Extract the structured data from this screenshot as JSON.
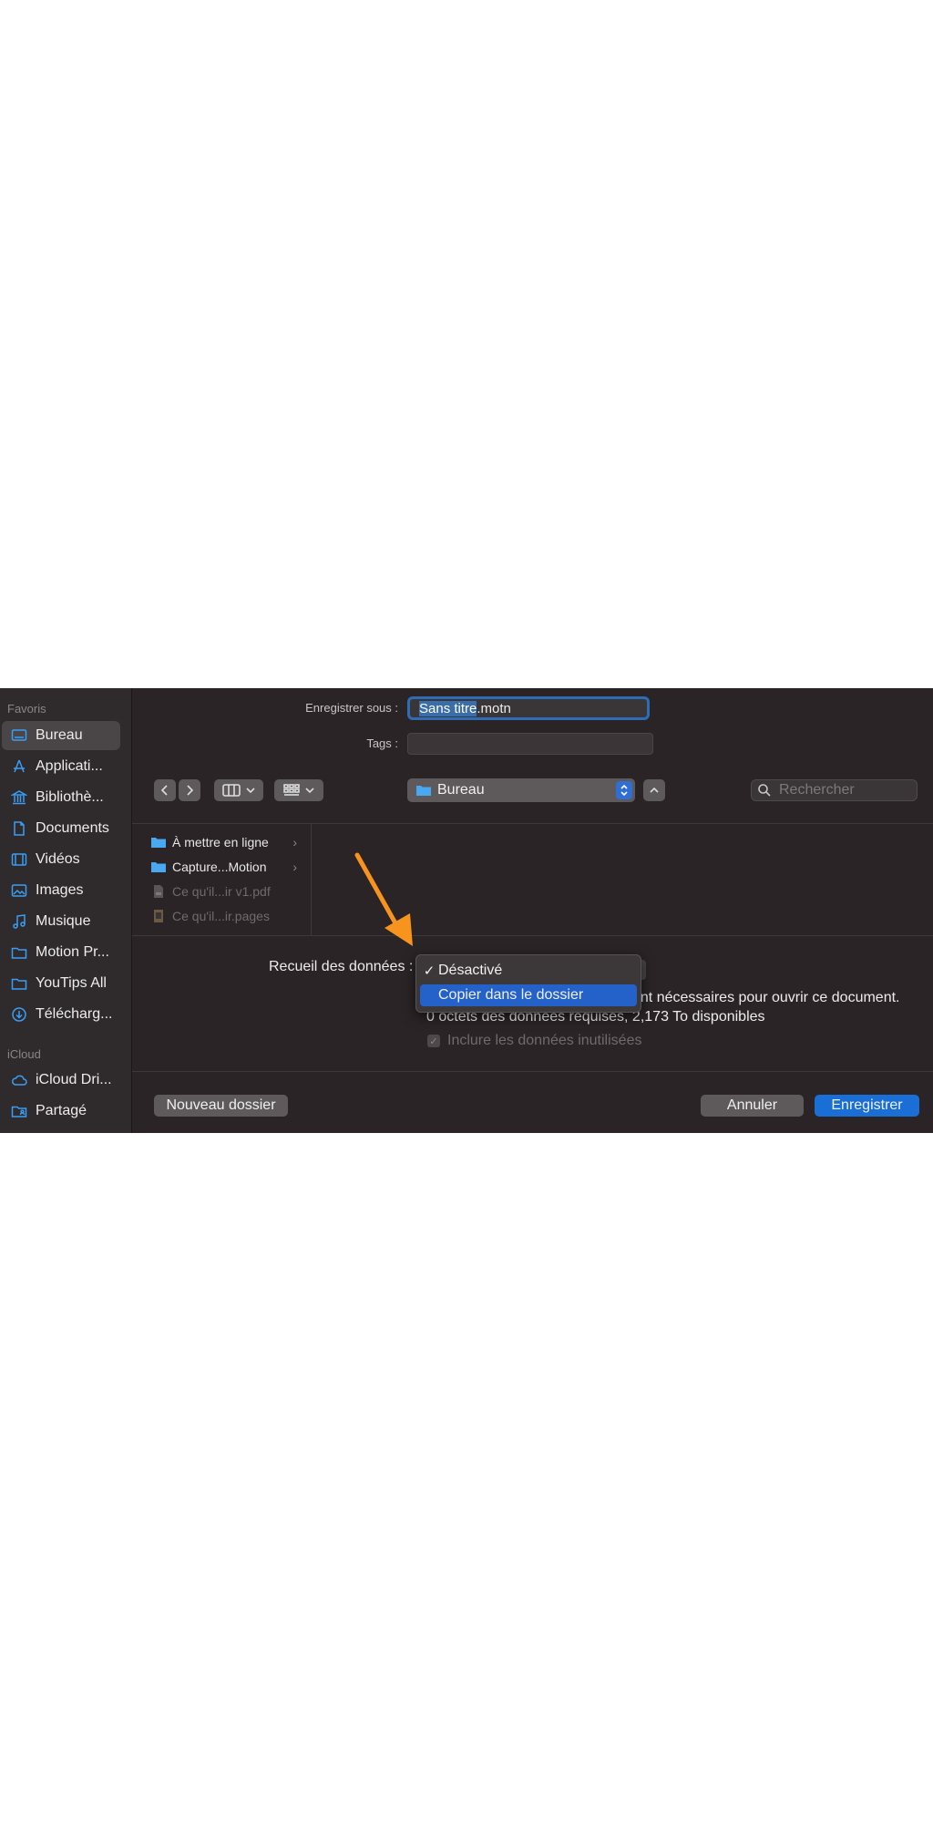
{
  "sidebar": {
    "favorites_header": "Favoris",
    "icloud_header": "iCloud",
    "items": [
      {
        "label": "Bureau",
        "icon": "desktop-icon"
      },
      {
        "label": "Applicati...",
        "icon": "applications-icon"
      },
      {
        "label": "Bibliothè...",
        "icon": "library-icon"
      },
      {
        "label": "Documents",
        "icon": "document-icon"
      },
      {
        "label": "Vidéos",
        "icon": "film-icon"
      },
      {
        "label": "Images",
        "icon": "photo-icon"
      },
      {
        "label": "Musique",
        "icon": "music-icon"
      },
      {
        "label": "Motion Pr...",
        "icon": "folder-icon"
      },
      {
        "label": "YouTips All",
        "icon": "folder-icon"
      },
      {
        "label": "Télécharg...",
        "icon": "download-icon"
      }
    ],
    "icloud_items": [
      {
        "label": "iCloud Dri...",
        "icon": "cloud-icon"
      },
      {
        "label": "Partagé",
        "icon": "shared-folder-icon"
      }
    ]
  },
  "save_as": {
    "label": "Enregistrer sous :",
    "filename_selected": "Sans titre",
    "filename_rest": ".motn"
  },
  "tags": {
    "label": "Tags :"
  },
  "location": {
    "current": "Bureau"
  },
  "search": {
    "placeholder": "Rechercher"
  },
  "files": [
    {
      "name": "À mettre en ligne",
      "type": "folder",
      "enabled": true
    },
    {
      "name": "Capture...Motion",
      "type": "folder",
      "enabled": true
    },
    {
      "name": "Ce qu'il...ir v1.pdf",
      "type": "pdf",
      "enabled": false
    },
    {
      "name": "Ce qu'il...ir.pages",
      "type": "pages",
      "enabled": false
    }
  ],
  "collect": {
    "label": "Recueil des données :",
    "options": [
      "Désactivé",
      "Copier dans le dossier"
    ],
    "checked_option": "Désactivé",
    "highlighted_option": "Copier dans le dossier",
    "check_glyph": "✓"
  },
  "info": {
    "line1": "ont nécessaires pour ouvrir ce document.",
    "line2": "0 octets des données requises, 2,173 To disponibles",
    "include_unused": "Inclure les données inutilisées"
  },
  "buttons": {
    "new_folder": "Nouveau dossier",
    "cancel": "Annuler",
    "save": "Enregistrer"
  },
  "colors": {
    "accent": "#1a6fd6",
    "arrow": "#f7941d",
    "dialog_bg": "#2a2426"
  }
}
